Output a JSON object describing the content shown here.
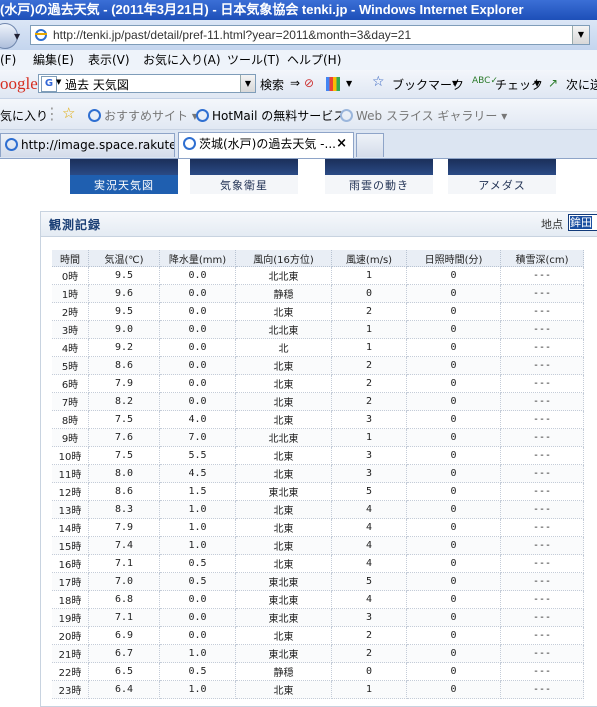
{
  "window": {
    "title": "(水戸)の過去天気 - (2011年3月21日) - 日本気象協会 tenki.jp - Windows Internet Explorer"
  },
  "address_bar": {
    "url": "http://tenki.jp/past/detail/pref-11.html?year=2011&month=3&day=21"
  },
  "menu": [
    "(F)",
    "編集(E)",
    "表示(V)",
    "お気に入り(A)",
    "ツール(T)",
    "ヘルプ(H)"
  ],
  "google_toolbar": {
    "logo": "oogle",
    "search_value": "過去  天気図",
    "search_label": "検索",
    "bookmark_label": "ブックマーク",
    "check_label": "チェック",
    "next_label": "次に送"
  },
  "favorites_bar": {
    "favorites_label": "気に入り",
    "items": [
      "おすすめサイト",
      "HotMail の無料サービス",
      "Web スライス ギャラリー"
    ]
  },
  "tabs": [
    {
      "label": "http://image.space.rakuten...."
    },
    {
      "label": "茨城(水戸)の過去天気 -..."
    }
  ],
  "map_tiles": [
    "実況天気図",
    "気象衛星",
    "雨雲の動き",
    "アメダス"
  ],
  "observation": {
    "title": "観測記録",
    "point_label": "地点",
    "point_value": "鉾田",
    "headers": [
      "時間",
      "気温(℃)",
      "降水量(mm)",
      "風向(16方位)",
      "風速(m/s)",
      "日照時間(分)",
      "積雪深(cm)"
    ],
    "rows": [
      [
        "0時",
        "9.5",
        "0.0",
        "北北東",
        "1",
        "0",
        "---"
      ],
      [
        "1時",
        "9.6",
        "0.0",
        "静穏",
        "0",
        "0",
        "---"
      ],
      [
        "2時",
        "9.5",
        "0.0",
        "北東",
        "2",
        "0",
        "---"
      ],
      [
        "3時",
        "9.0",
        "0.0",
        "北北東",
        "1",
        "0",
        "---"
      ],
      [
        "4時",
        "9.2",
        "0.0",
        "北",
        "1",
        "0",
        "---"
      ],
      [
        "5時",
        "8.6",
        "0.0",
        "北東",
        "2",
        "0",
        "---"
      ],
      [
        "6時",
        "7.9",
        "0.0",
        "北東",
        "2",
        "0",
        "---"
      ],
      [
        "7時",
        "8.2",
        "0.0",
        "北東",
        "2",
        "0",
        "---"
      ],
      [
        "8時",
        "7.5",
        "4.0",
        "北東",
        "3",
        "0",
        "---"
      ],
      [
        "9時",
        "7.6",
        "7.0",
        "北北東",
        "1",
        "0",
        "---"
      ],
      [
        "10時",
        "7.5",
        "5.5",
        "北東",
        "3",
        "0",
        "---"
      ],
      [
        "11時",
        "8.0",
        "4.5",
        "北東",
        "3",
        "0",
        "---"
      ],
      [
        "12時",
        "8.6",
        "1.5",
        "東北東",
        "5",
        "0",
        "---"
      ],
      [
        "13時",
        "8.3",
        "1.0",
        "北東",
        "4",
        "0",
        "---"
      ],
      [
        "14時",
        "7.9",
        "1.0",
        "北東",
        "4",
        "0",
        "---"
      ],
      [
        "15時",
        "7.4",
        "1.0",
        "北東",
        "4",
        "0",
        "---"
      ],
      [
        "16時",
        "7.1",
        "0.5",
        "北東",
        "4",
        "0",
        "---"
      ],
      [
        "17時",
        "7.0",
        "0.5",
        "東北東",
        "5",
        "0",
        "---"
      ],
      [
        "18時",
        "6.8",
        "0.0",
        "東北東",
        "4",
        "0",
        "---"
      ],
      [
        "19時",
        "7.1",
        "0.0",
        "東北東",
        "3",
        "0",
        "---"
      ],
      [
        "20時",
        "6.9",
        "0.0",
        "北東",
        "2",
        "0",
        "---"
      ],
      [
        "21時",
        "6.7",
        "1.0",
        "東北東",
        "2",
        "0",
        "---"
      ],
      [
        "22時",
        "6.5",
        "0.5",
        "静穏",
        "0",
        "0",
        "---"
      ],
      [
        "23時",
        "6.4",
        "1.0",
        "北東",
        "1",
        "0",
        "---"
      ]
    ]
  }
}
